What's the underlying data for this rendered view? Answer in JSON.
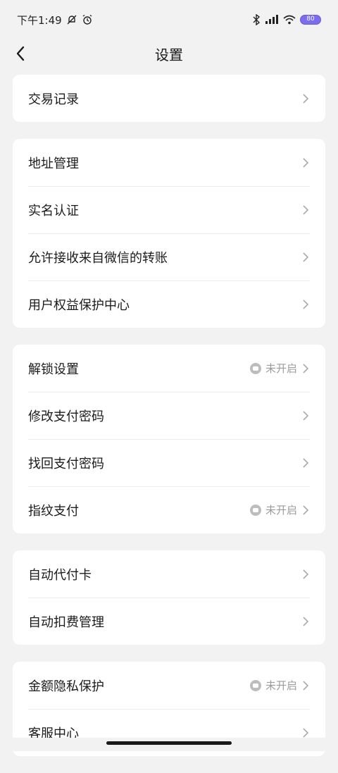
{
  "status_bar": {
    "time": "下午1:49",
    "battery": "80"
  },
  "nav": {
    "title": "设置"
  },
  "sections": [
    {
      "items": [
        {
          "label": "交易记录",
          "status": ""
        }
      ]
    },
    {
      "items": [
        {
          "label": "地址管理",
          "status": ""
        },
        {
          "label": "实名认证",
          "status": ""
        },
        {
          "label": "允许接收来自微信的转账",
          "status": ""
        },
        {
          "label": "用户权益保护中心",
          "status": ""
        }
      ]
    },
    {
      "items": [
        {
          "label": "解锁设置",
          "status": "未开启"
        },
        {
          "label": "修改支付密码",
          "status": ""
        },
        {
          "label": "找回支付密码",
          "status": ""
        },
        {
          "label": "指纹支付",
          "status": "未开启"
        }
      ]
    },
    {
      "items": [
        {
          "label": "自动代付卡",
          "status": ""
        },
        {
          "label": "自动扣费管理",
          "status": ""
        }
      ]
    },
    {
      "items": [
        {
          "label": "金额隐私保护",
          "status": "未开启"
        },
        {
          "label": "客服中心",
          "status": ""
        }
      ]
    }
  ]
}
